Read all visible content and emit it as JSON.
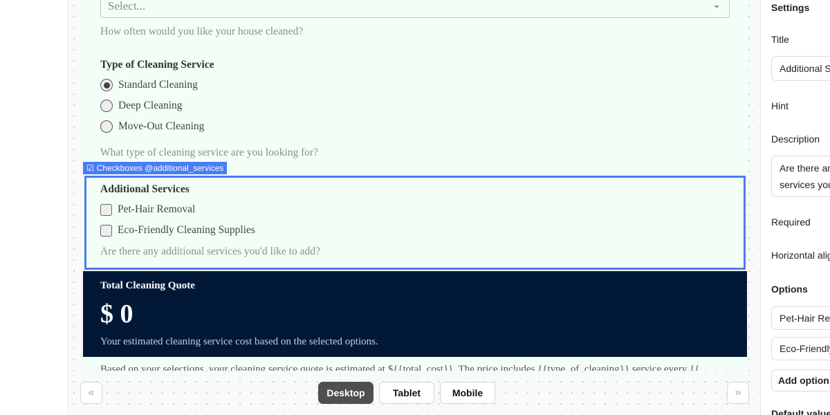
{
  "form": {
    "frequency": {
      "placeholder": "Select...",
      "hint": "How often would you like your house cleaned?"
    },
    "cleaning_type": {
      "label": "Type of Cleaning Service",
      "options": [
        "Standard Cleaning",
        "Deep Cleaning",
        "Move-Out Cleaning"
      ],
      "selected": "Standard Cleaning",
      "hint": "What type of cleaning service are you looking for?"
    },
    "additional_services": {
      "tag": "Checkboxes @additional_services",
      "label": "Additional Services",
      "options": [
        "Pet-Hair Removal",
        "Eco-Friendly Cleaning Supplies"
      ],
      "hint": "Are there any additional services you'd like to add?"
    },
    "quote": {
      "title": "Total Cleaning Quote",
      "value": "$ 0",
      "description": "Your estimated cleaning service cost based on the selected options."
    },
    "summary": "Based on your selections, your cleaning service quote is estimated at ${{total_cost}}. The price includes {{type_of_cleaning}} service every {{"
  },
  "toolbar": {
    "devices": [
      "Desktop",
      "Tablet",
      "Mobile"
    ],
    "active": "Desktop",
    "prev": "«",
    "next": "»"
  },
  "settings": {
    "heading": "Settings",
    "title_label": "Title",
    "title_value": "Additional Services",
    "hint_label": "Hint",
    "description_label": "Description",
    "description_value": "Are there any additional services you'd like to add?",
    "required_label": "Required",
    "halign_label": "Horizontal alignment",
    "options_label": "Options",
    "options": [
      "Pet-Hair Removal",
      "Eco-Friendly Cleaning Supplies"
    ],
    "add_option": "Add option",
    "default_label": "Default value"
  },
  "colors": {
    "accent": "#4a7cf6",
    "quote_bg": "#011936",
    "form_bg": "#f3fff6"
  }
}
